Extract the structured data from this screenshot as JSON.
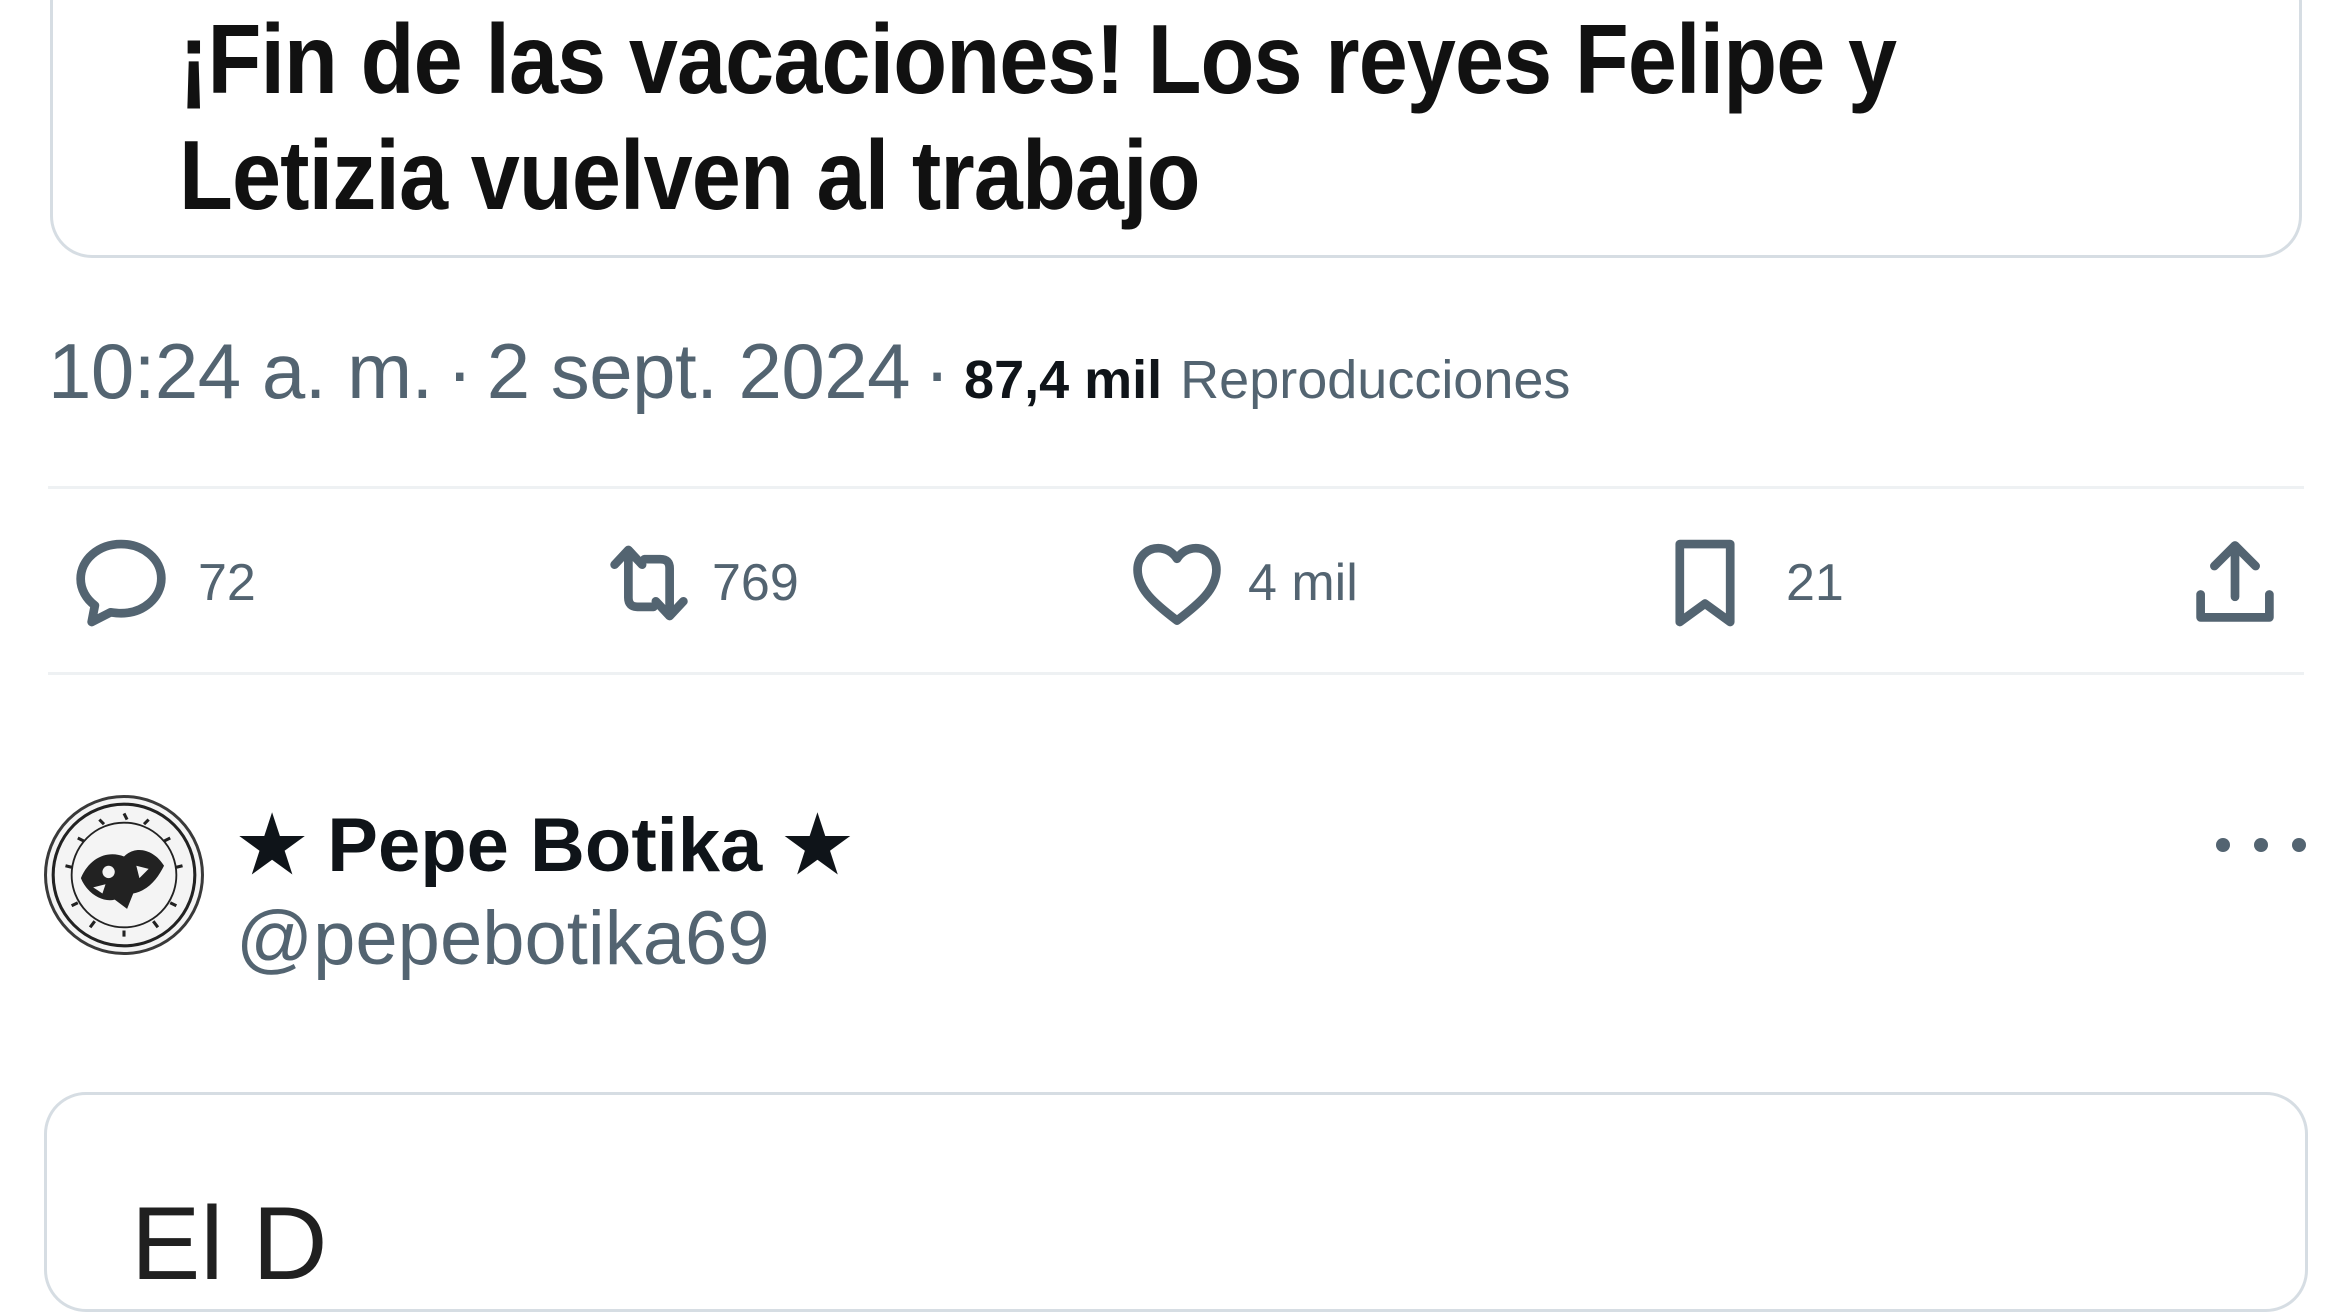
{
  "quoted_card": {
    "headline": "¡Fin de las vacaciones! Los reyes Felipe y Letizia vuelven al trabajo"
  },
  "tweet_meta": {
    "time": "10:24 a. m.",
    "separator": "·",
    "date": "2 sept. 2024",
    "views_count": "87,4 mil",
    "views_label": "Reproducciones"
  },
  "actions": {
    "replies": "72",
    "retweets": "769",
    "likes": "4 mil",
    "bookmarks": "21"
  },
  "next_tweet": {
    "display_name": "★ Pepe Botika ★",
    "handle": "@pepebotika69",
    "card_headline": "El D"
  },
  "colors": {
    "text_primary": "#0f1419",
    "text_secondary": "#536471",
    "border": "#d6dde3",
    "divider": "#eef1f3"
  },
  "icons": [
    "reply-icon",
    "retweet-icon",
    "like-icon",
    "bookmark-icon",
    "share-icon",
    "more-icon"
  ]
}
